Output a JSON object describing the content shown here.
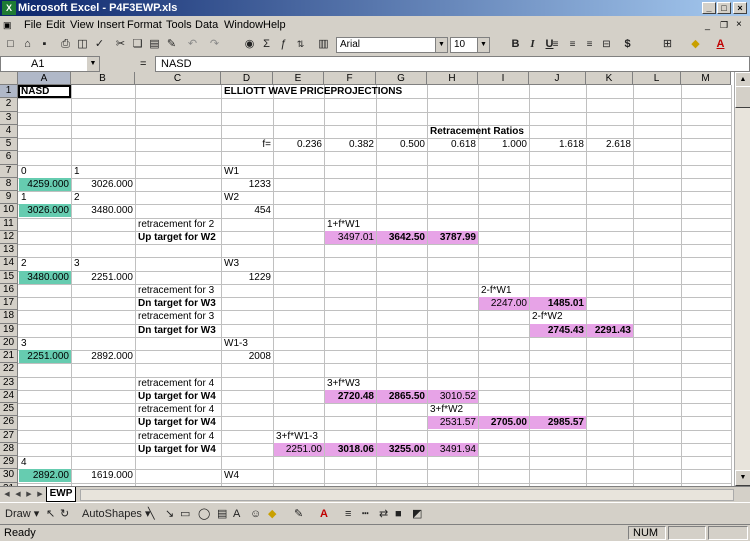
{
  "window": {
    "title": "Microsoft Excel - P4F3EWP.xls",
    "app_icon": "excel-icon",
    "controls": [
      "minimize-icon",
      "maximize-icon",
      "close-icon"
    ]
  },
  "menu": {
    "items": [
      "File",
      "Edit",
      "View",
      "Insert",
      "Format",
      "Tools",
      "Data",
      "Window",
      "Help"
    ]
  },
  "toolbar": {
    "font_name": "Arial",
    "font_size": "10",
    "bold": "B",
    "italic": "I",
    "underline": "U",
    "currency": "$"
  },
  "formula_bar": {
    "name_box": "A1",
    "equals": "=",
    "content": "NASD"
  },
  "columns": [
    "A",
    "B",
    "C",
    "D",
    "E",
    "F",
    "G",
    "H",
    "I",
    "J",
    "K",
    "L",
    "M"
  ],
  "rows": [
    "1",
    "2",
    "3",
    "4",
    "5",
    "6",
    "7",
    "8",
    "9",
    "10",
    "11",
    "12",
    "13",
    "14",
    "15",
    "16",
    "17",
    "18",
    "19",
    "20",
    "21",
    "22",
    "23",
    "24",
    "25",
    "26",
    "27",
    "28",
    "29",
    "30",
    "31"
  ],
  "cells": [
    {
      "r": 1,
      "c": 0,
      "t": "NASD",
      "b": true
    },
    {
      "r": 1,
      "c": 3,
      "t": "ELLIOTT WAVE PRICEPROJECTIONS",
      "b": true
    },
    {
      "r": 4,
      "c": 7,
      "t": "Retracement Ratios",
      "b": true,
      "align": "center"
    },
    {
      "r": 5,
      "c": 3,
      "t": "f=",
      "num": true
    },
    {
      "r": 5,
      "c": 4,
      "t": "0.236",
      "num": true
    },
    {
      "r": 5,
      "c": 5,
      "t": "0.382",
      "num": true
    },
    {
      "r": 5,
      "c": 6,
      "t": "0.500",
      "num": true
    },
    {
      "r": 5,
      "c": 7,
      "t": "0.618",
      "num": true
    },
    {
      "r": 5,
      "c": 8,
      "t": "1.000",
      "num": true
    },
    {
      "r": 5,
      "c": 9,
      "t": "1.618",
      "num": true
    },
    {
      "r": 5,
      "c": 10,
      "t": "2.618",
      "num": true
    },
    {
      "r": 7,
      "c": 0,
      "t": "0"
    },
    {
      "r": 7,
      "c": 1,
      "t": "1"
    },
    {
      "r": 7,
      "c": 3,
      "t": "W1"
    },
    {
      "r": 8,
      "c": 0,
      "t": "4259.000",
      "num": true,
      "bg": "green"
    },
    {
      "r": 8,
      "c": 1,
      "t": "3026.000",
      "num": true
    },
    {
      "r": 8,
      "c": 3,
      "t": "1233",
      "num": true
    },
    {
      "r": 9,
      "c": 0,
      "t": "1"
    },
    {
      "r": 9,
      "c": 1,
      "t": "2"
    },
    {
      "r": 9,
      "c": 3,
      "t": "W2"
    },
    {
      "r": 10,
      "c": 0,
      "t": "3026.000",
      "num": true,
      "bg": "green"
    },
    {
      "r": 10,
      "c": 1,
      "t": "3480.000",
      "num": true
    },
    {
      "r": 10,
      "c": 3,
      "t": "454",
      "num": true
    },
    {
      "r": 11,
      "c": 2,
      "t": "retracement for 2"
    },
    {
      "r": 11,
      "c": 5,
      "t": "1+f*W1"
    },
    {
      "r": 12,
      "c": 2,
      "t": "Up target for W2",
      "b": true
    },
    {
      "r": 12,
      "c": 5,
      "t": "3497.01",
      "num": true,
      "bg": "pink"
    },
    {
      "r": 12,
      "c": 6,
      "t": "3642.50",
      "num": true,
      "bg": "pink",
      "b": true
    },
    {
      "r": 12,
      "c": 7,
      "t": "3787.99",
      "num": true,
      "bg": "pink",
      "b": true
    },
    {
      "r": 14,
      "c": 0,
      "t": "2"
    },
    {
      "r": 14,
      "c": 1,
      "t": "3"
    },
    {
      "r": 14,
      "c": 3,
      "t": "W3"
    },
    {
      "r": 15,
      "c": 0,
      "t": "3480.000",
      "num": true,
      "bg": "green"
    },
    {
      "r": 15,
      "c": 1,
      "t": "2251.000",
      "num": true
    },
    {
      "r": 15,
      "c": 3,
      "t": "1229",
      "num": true
    },
    {
      "r": 16,
      "c": 2,
      "t": "retracement for 3"
    },
    {
      "r": 16,
      "c": 8,
      "t": "2-f*W1"
    },
    {
      "r": 17,
      "c": 2,
      "t": "Dn target for W3",
      "b": true
    },
    {
      "r": 17,
      "c": 8,
      "t": "2247.00",
      "num": true,
      "bg": "pink"
    },
    {
      "r": 17,
      "c": 9,
      "t": "1485.01",
      "num": true,
      "bg": "pink",
      "b": true
    },
    {
      "r": 18,
      "c": 2,
      "t": "retracement for 3"
    },
    {
      "r": 18,
      "c": 9,
      "t": "2-f*W2"
    },
    {
      "r": 19,
      "c": 2,
      "t": "Dn target for W3",
      "b": true
    },
    {
      "r": 19,
      "c": 9,
      "t": "2745.43",
      "num": true,
      "bg": "pink",
      "b": true
    },
    {
      "r": 19,
      "c": 10,
      "t": "2291.43",
      "num": true,
      "bg": "pink",
      "b": true
    },
    {
      "r": 20,
      "c": 0,
      "t": "3"
    },
    {
      "r": 20,
      "c": 3,
      "t": "W1-3"
    },
    {
      "r": 21,
      "c": 0,
      "t": "2251.000",
      "num": true,
      "bg": "green"
    },
    {
      "r": 21,
      "c": 1,
      "t": "2892.000",
      "num": true
    },
    {
      "r": 21,
      "c": 3,
      "t": "2008",
      "num": true
    },
    {
      "r": 23,
      "c": 2,
      "t": "retracement for 4"
    },
    {
      "r": 23,
      "c": 5,
      "t": "3+f*W3"
    },
    {
      "r": 24,
      "c": 2,
      "t": "Up target for W4",
      "b": true
    },
    {
      "r": 24,
      "c": 5,
      "t": "2720.48",
      "num": true,
      "bg": "pink",
      "b": true
    },
    {
      "r": 24,
      "c": 6,
      "t": "2865.50",
      "num": true,
      "bg": "pink",
      "b": true
    },
    {
      "r": 24,
      "c": 7,
      "t": "3010.52",
      "num": true,
      "bg": "pink"
    },
    {
      "r": 25,
      "c": 2,
      "t": "retracement for 4"
    },
    {
      "r": 25,
      "c": 7,
      "t": "3+f*W2"
    },
    {
      "r": 26,
      "c": 2,
      "t": "Up target for W4",
      "b": true
    },
    {
      "r": 26,
      "c": 7,
      "t": "2531.57",
      "num": true,
      "bg": "pink"
    },
    {
      "r": 26,
      "c": 8,
      "t": "2705.00",
      "num": true,
      "bg": "pink",
      "b": true
    },
    {
      "r": 26,
      "c": 9,
      "t": "2985.57",
      "num": true,
      "bg": "pink",
      "b": true
    },
    {
      "r": 27,
      "c": 2,
      "t": "retracement for 4"
    },
    {
      "r": 27,
      "c": 4,
      "t": "3+f*W1-3"
    },
    {
      "r": 28,
      "c": 2,
      "t": "Up target for W4",
      "b": true
    },
    {
      "r": 28,
      "c": 4,
      "t": "2251.00",
      "num": true,
      "bg": "pink"
    },
    {
      "r": 28,
      "c": 5,
      "t": "3018.06",
      "num": true,
      "bg": "pink",
      "b": true
    },
    {
      "r": 28,
      "c": 6,
      "t": "3255.00",
      "num": true,
      "bg": "pink",
      "b": true
    },
    {
      "r": 28,
      "c": 7,
      "t": "3491.94",
      "num": true,
      "bg": "pink"
    },
    {
      "r": 29,
      "c": 0,
      "t": "4"
    },
    {
      "r": 30,
      "c": 0,
      "t": "2892.00",
      "num": true,
      "bg": "green"
    },
    {
      "r": 30,
      "c": 1,
      "t": "1619.000",
      "num": true
    },
    {
      "r": 30,
      "c": 3,
      "t": "W4"
    }
  ],
  "colors": {
    "green": "#66ccb0",
    "pink": "#e7a3e7",
    "titlebar": "#0a246a"
  },
  "sheet_tabs": [
    "EWP"
  ],
  "drawing_toolbar": {
    "draw": "Draw",
    "autoshapes": "AutoShapes"
  },
  "status": {
    "ready": "Ready",
    "num": "NUM"
  }
}
